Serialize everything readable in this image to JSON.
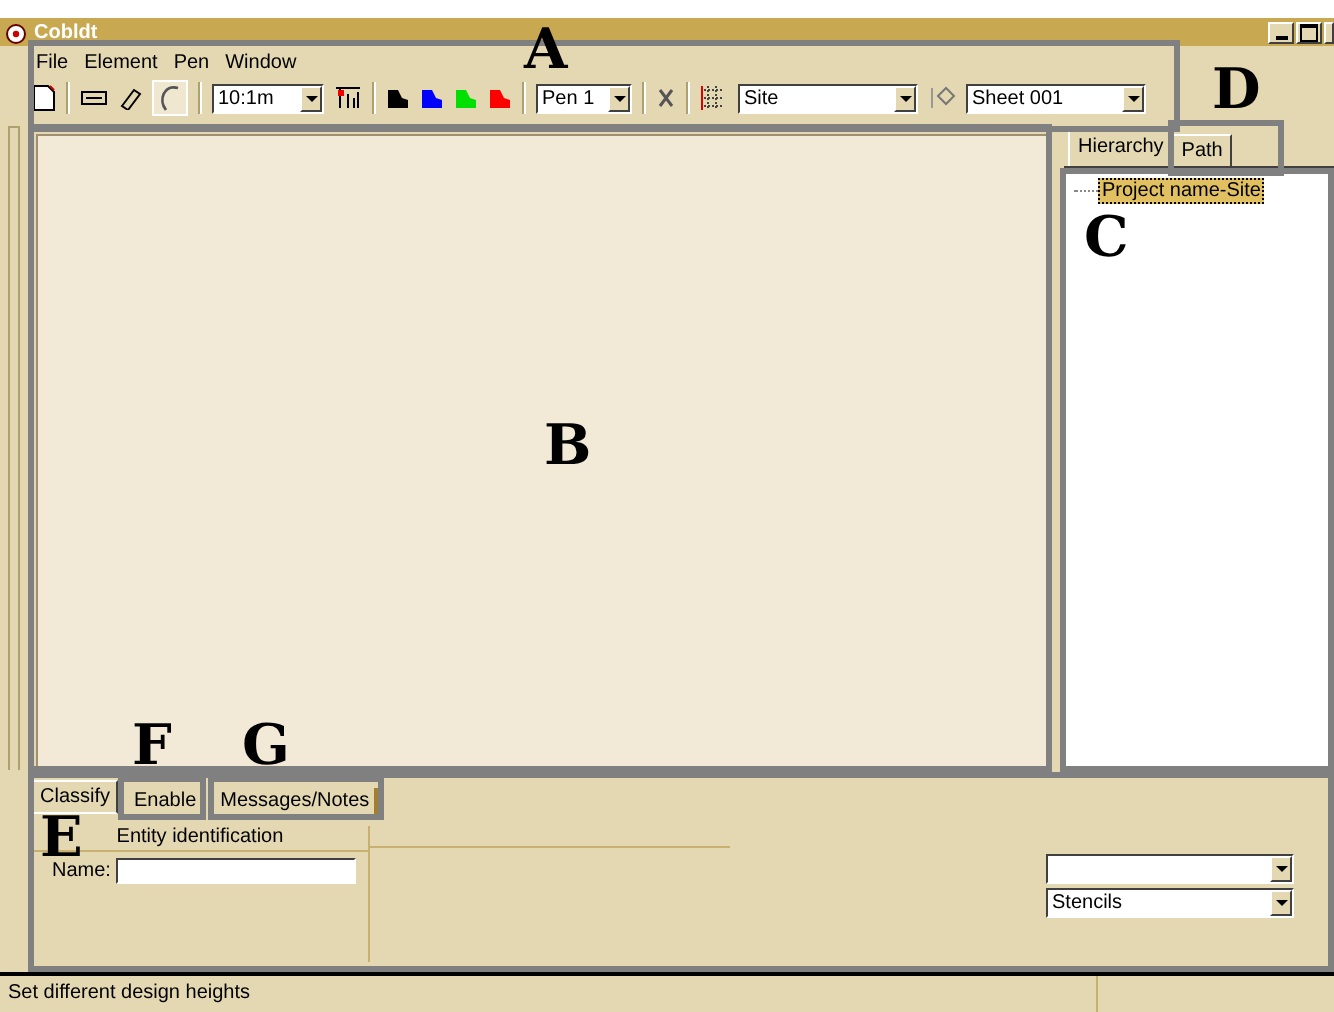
{
  "window": {
    "title": "Cobldt"
  },
  "menu": [
    "File",
    "Element",
    "Pen",
    "Window"
  ],
  "toolbar": {
    "scale": "10:1m",
    "pen": "Pen 1",
    "layer": "Site",
    "sheet": "Sheet 001"
  },
  "pen_colors": [
    {
      "color": "#000000"
    },
    {
      "color": "#0000ff"
    },
    {
      "color": "#00e000"
    },
    {
      "color": "#ff0000"
    }
  ],
  "side_tabs": [
    {
      "label": "Hierarchy",
      "selected": true
    },
    {
      "label": "Path",
      "selected": false
    }
  ],
  "tree": [
    {
      "label": "Project name-Site",
      "selected": true
    }
  ],
  "bottom_tabs": [
    {
      "label": "Classify",
      "selected": true
    },
    {
      "label": "Enable",
      "selected": false
    },
    {
      "label": "Messages/Notes",
      "selected": false
    }
  ],
  "entity": {
    "heading": "Entity identification",
    "name_label": "Name:"
  },
  "stencil_dropdown": {
    "value": "Stencils"
  },
  "status_bar": "Set different design heights",
  "annotations": [
    "A",
    "B",
    "C",
    "D",
    "E",
    "F",
    "G"
  ]
}
